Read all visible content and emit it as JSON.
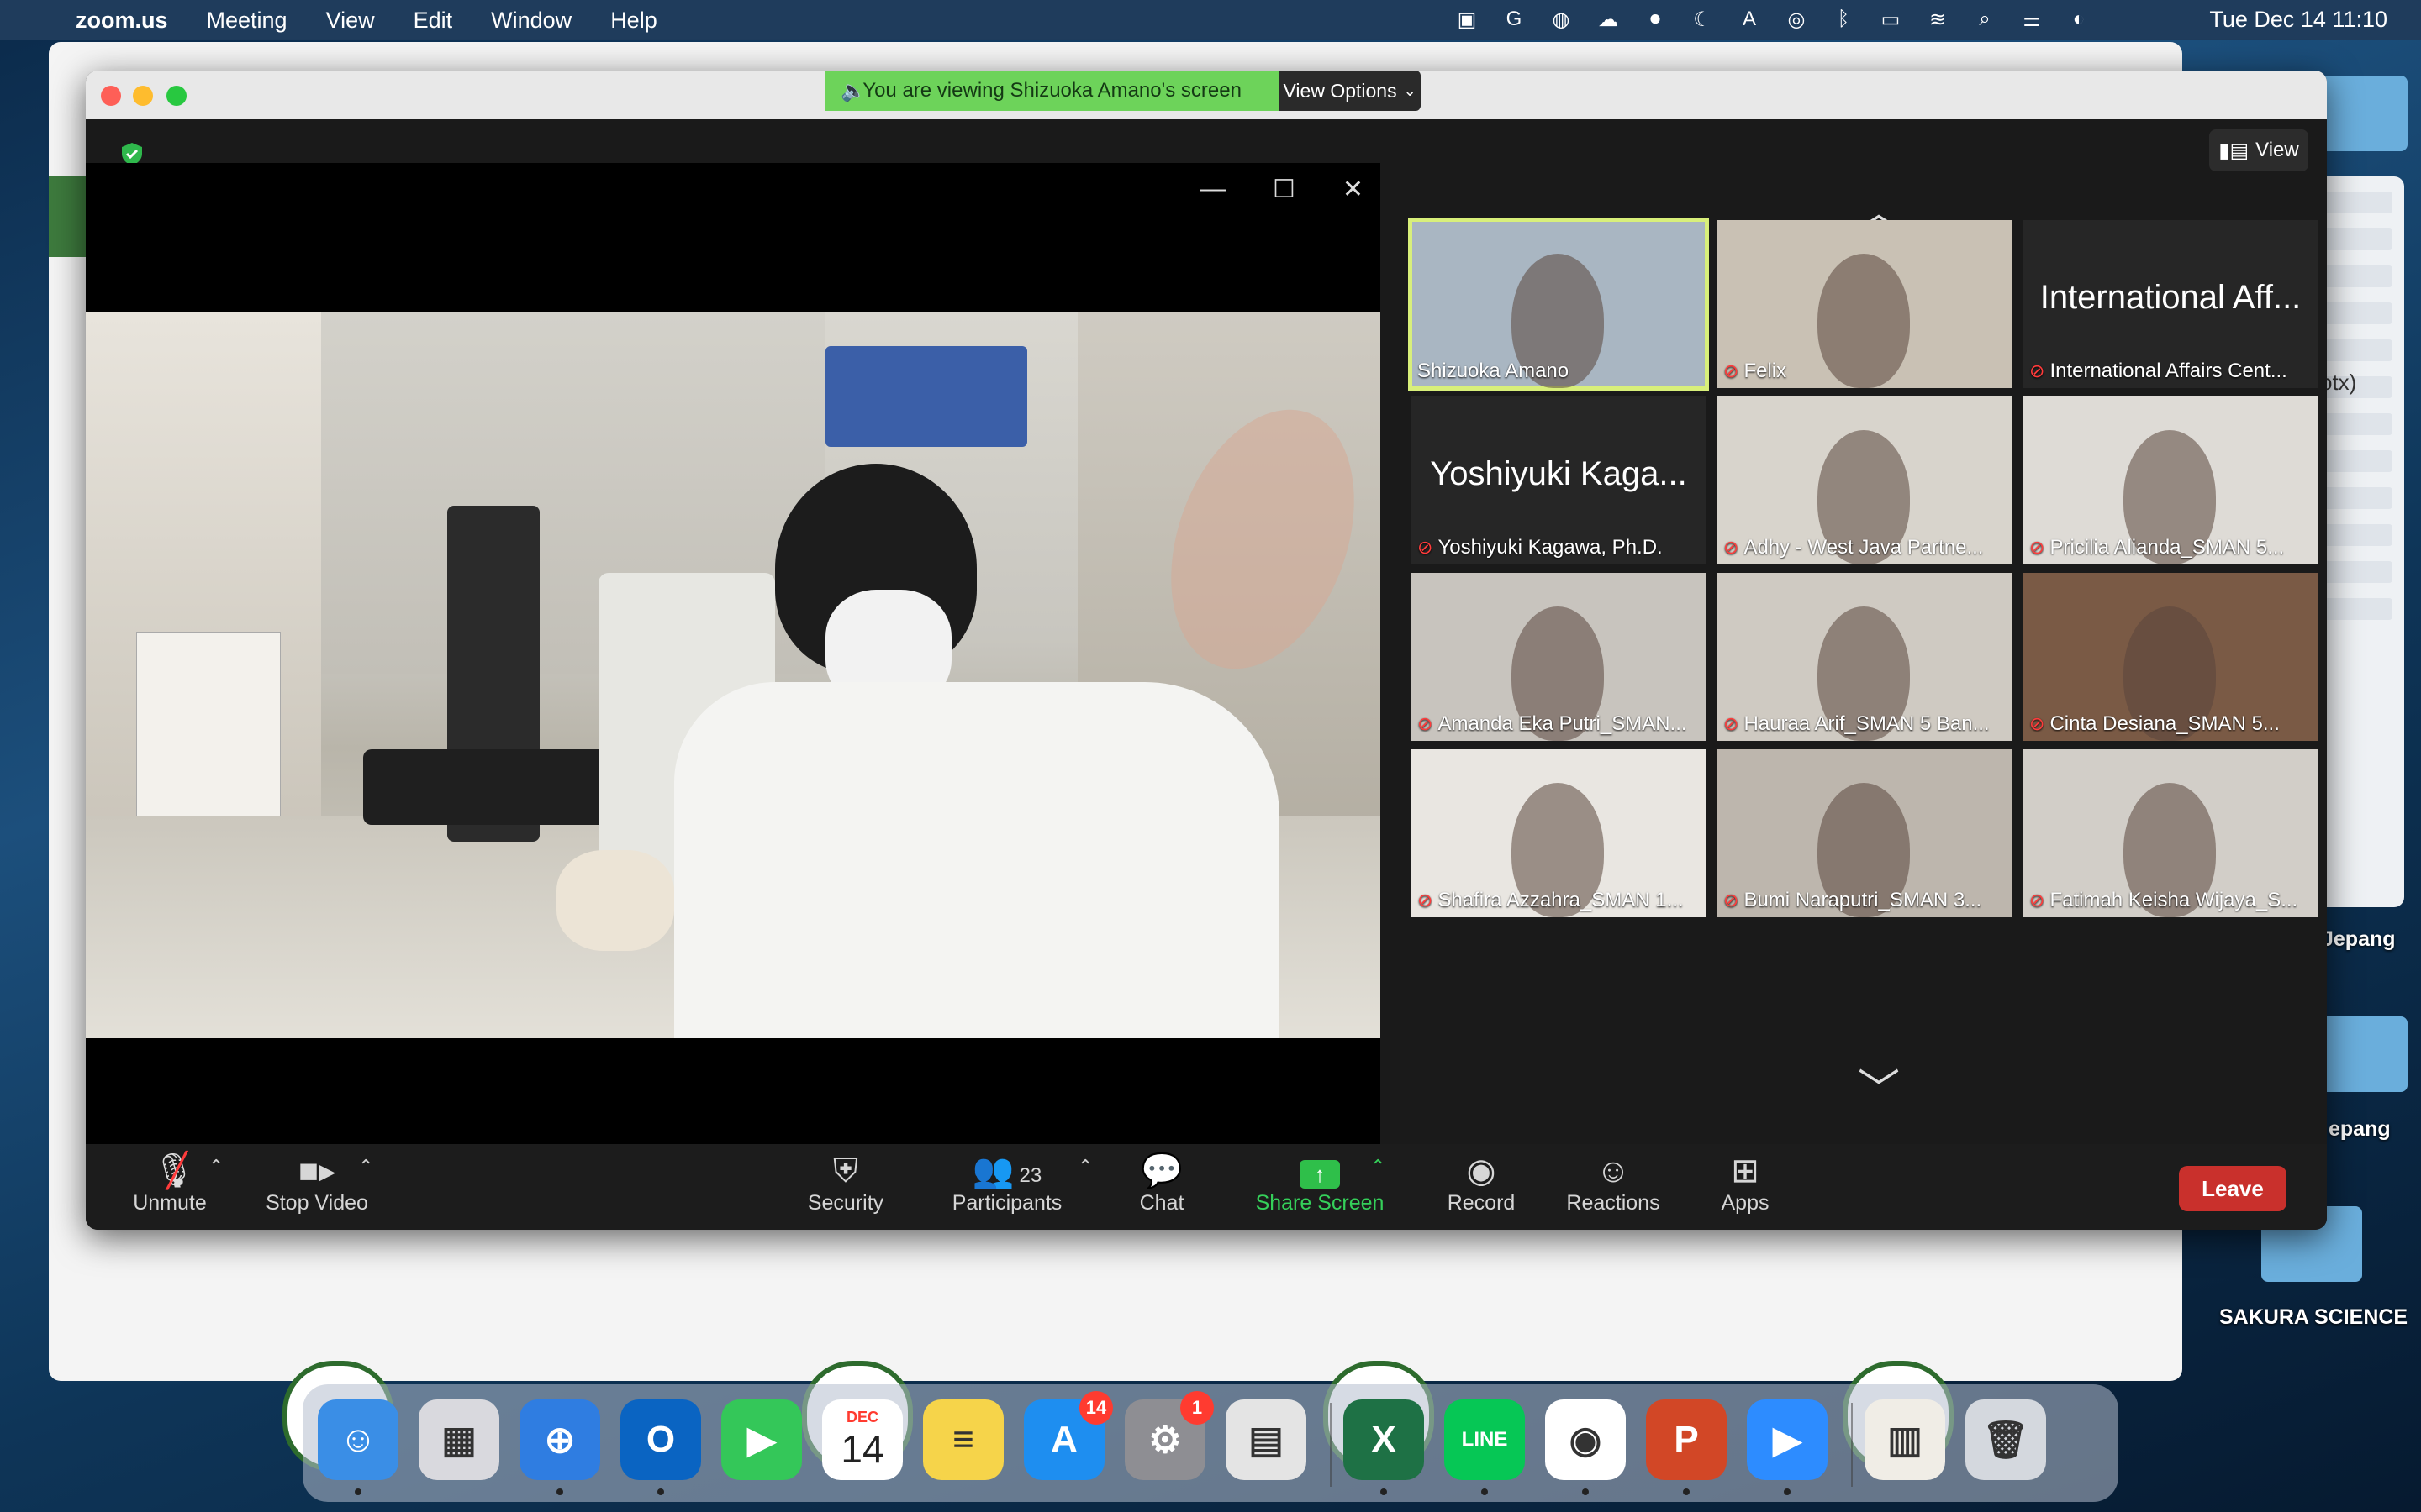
{
  "menubar": {
    "app_name": "zoom.us",
    "items": [
      "Meeting",
      "View",
      "Edit",
      "Window",
      "Help"
    ],
    "clock": "Tue Dec 14  11:10",
    "status_icons": [
      "zoom-icon",
      "grammarly-icon",
      "line-icon",
      "cloud-icon",
      "screen-record-icon",
      "moon-icon",
      "input-source-icon",
      "airdrop-icon",
      "bluetooth-icon",
      "battery-icon",
      "wifi-icon",
      "search-icon",
      "control-center-icon",
      "siri-icon"
    ],
    "input_source": "A"
  },
  "desktop": {
    "right_window_text": "otx)",
    "folders": [
      {
        "label": "Jepang"
      },
      {
        "label": "epang"
      },
      {
        "label": "SAKURA SCIENCE"
      }
    ]
  },
  "zoom": {
    "banner": {
      "text": "You are viewing Shizuoka Amano's screen",
      "view_options": "View Options"
    },
    "view_button": "View",
    "gallery": {
      "tiles": [
        {
          "name": "Shizuoka Amano",
          "muted": false,
          "active": true,
          "video": true,
          "bg": "#a9b6c2"
        },
        {
          "name": "Felix",
          "muted": true,
          "active": false,
          "video": true,
          "bg": "#c9c1b4"
        },
        {
          "name": "International Affairs Cent...",
          "big": "International Aff...",
          "muted": true,
          "active": false,
          "video": false
        },
        {
          "name": "Yoshiyuki Kagawa, Ph.D.",
          "big": "Yoshiyuki Kaga...",
          "muted": true,
          "active": false,
          "video": false
        },
        {
          "name": "Adhy - West Java Partne...",
          "muted": true,
          "active": false,
          "video": true,
          "bg": "#d8d4cc"
        },
        {
          "name": "Pricilia Alianda_SMAN 5...",
          "muted": true,
          "active": false,
          "video": true,
          "bg": "#dedbd6"
        },
        {
          "name": "Amanda Eka Putri_SMAN...",
          "muted": true,
          "active": false,
          "video": true,
          "bg": "#c8c4be"
        },
        {
          "name": "Hauraa Arif_SMAN 5 Ban...",
          "muted": true,
          "active": false,
          "video": true,
          "bg": "#cfcac2"
        },
        {
          "name": "Cinta Desiana_SMAN 5...",
          "muted": true,
          "active": false,
          "video": true,
          "bg": "#7a5a45"
        },
        {
          "name": "Shafira Azzahra_SMAN 1...",
          "muted": true,
          "active": false,
          "video": true,
          "bg": "#e9e6e1"
        },
        {
          "name": "Bumi Naraputri_SMAN 3...",
          "muted": true,
          "active": false,
          "video": true,
          "bg": "#bdb6ad"
        },
        {
          "name": "Fatimah Keisha Wijaya_S...",
          "muted": true,
          "active": false,
          "video": true,
          "bg": "#d2cec8"
        }
      ]
    },
    "toolbar": {
      "unmute": "Unmute",
      "stop_video": "Stop Video",
      "security": "Security",
      "participants": "Participants",
      "participants_count": "23",
      "chat": "Chat",
      "share_screen": "Share Screen",
      "record": "Record",
      "reactions": "Reactions",
      "apps": "Apps",
      "leave": "Leave"
    }
  },
  "dock": {
    "apps": [
      {
        "name": "finder-icon",
        "glyph": "☺",
        "color": "#3a8ee6",
        "dot": true
      },
      {
        "name": "launchpad-icon",
        "glyph": "▦",
        "color": "#d9d9de",
        "dot": false
      },
      {
        "name": "safari-icon",
        "glyph": "⊕",
        "color": "#2f7de1",
        "dot": true
      },
      {
        "name": "outlook-icon",
        "glyph": "O",
        "color": "#0a64c2",
        "dot": true
      },
      {
        "name": "facetime-icon",
        "glyph": "▶",
        "color": "#34c759",
        "dot": false
      },
      {
        "name": "calendar-icon",
        "glyph": "14",
        "color": "#ffffff",
        "dot": false,
        "calendar_month": "DEC"
      },
      {
        "name": "notes-icon",
        "glyph": "≡",
        "color": "#f6d44a",
        "dot": false
      },
      {
        "name": "app-store-icon",
        "glyph": "A",
        "color": "#1e8ef0",
        "dot": false,
        "badge": "14"
      },
      {
        "name": "system-preferences-icon",
        "glyph": "⚙",
        "color": "#8e8e93",
        "dot": false,
        "badge": "1"
      },
      {
        "name": "printer-icon",
        "glyph": "▤",
        "color": "#e4e4e4",
        "dot": false
      },
      {
        "name": "excel-icon",
        "glyph": "X",
        "color": "#1e7145",
        "dot": true
      },
      {
        "name": "line-icon",
        "glyph": "LINE",
        "color": "#06c755",
        "dot": true
      },
      {
        "name": "chrome-icon",
        "glyph": "◉",
        "color": "#ffffff",
        "dot": true
      },
      {
        "name": "powerpoint-icon",
        "glyph": "P",
        "color": "#d24726",
        "dot": true
      },
      {
        "name": "zoom-app-icon",
        "glyph": "▶",
        "color": "#2d8cff",
        "dot": true
      },
      {
        "name": "downloads-stack-icon",
        "glyph": "▥",
        "color": "#f0ede6",
        "dot": false
      },
      {
        "name": "trash-icon",
        "glyph": "🗑",
        "color": "#d4d8de",
        "dot": false
      }
    ]
  }
}
